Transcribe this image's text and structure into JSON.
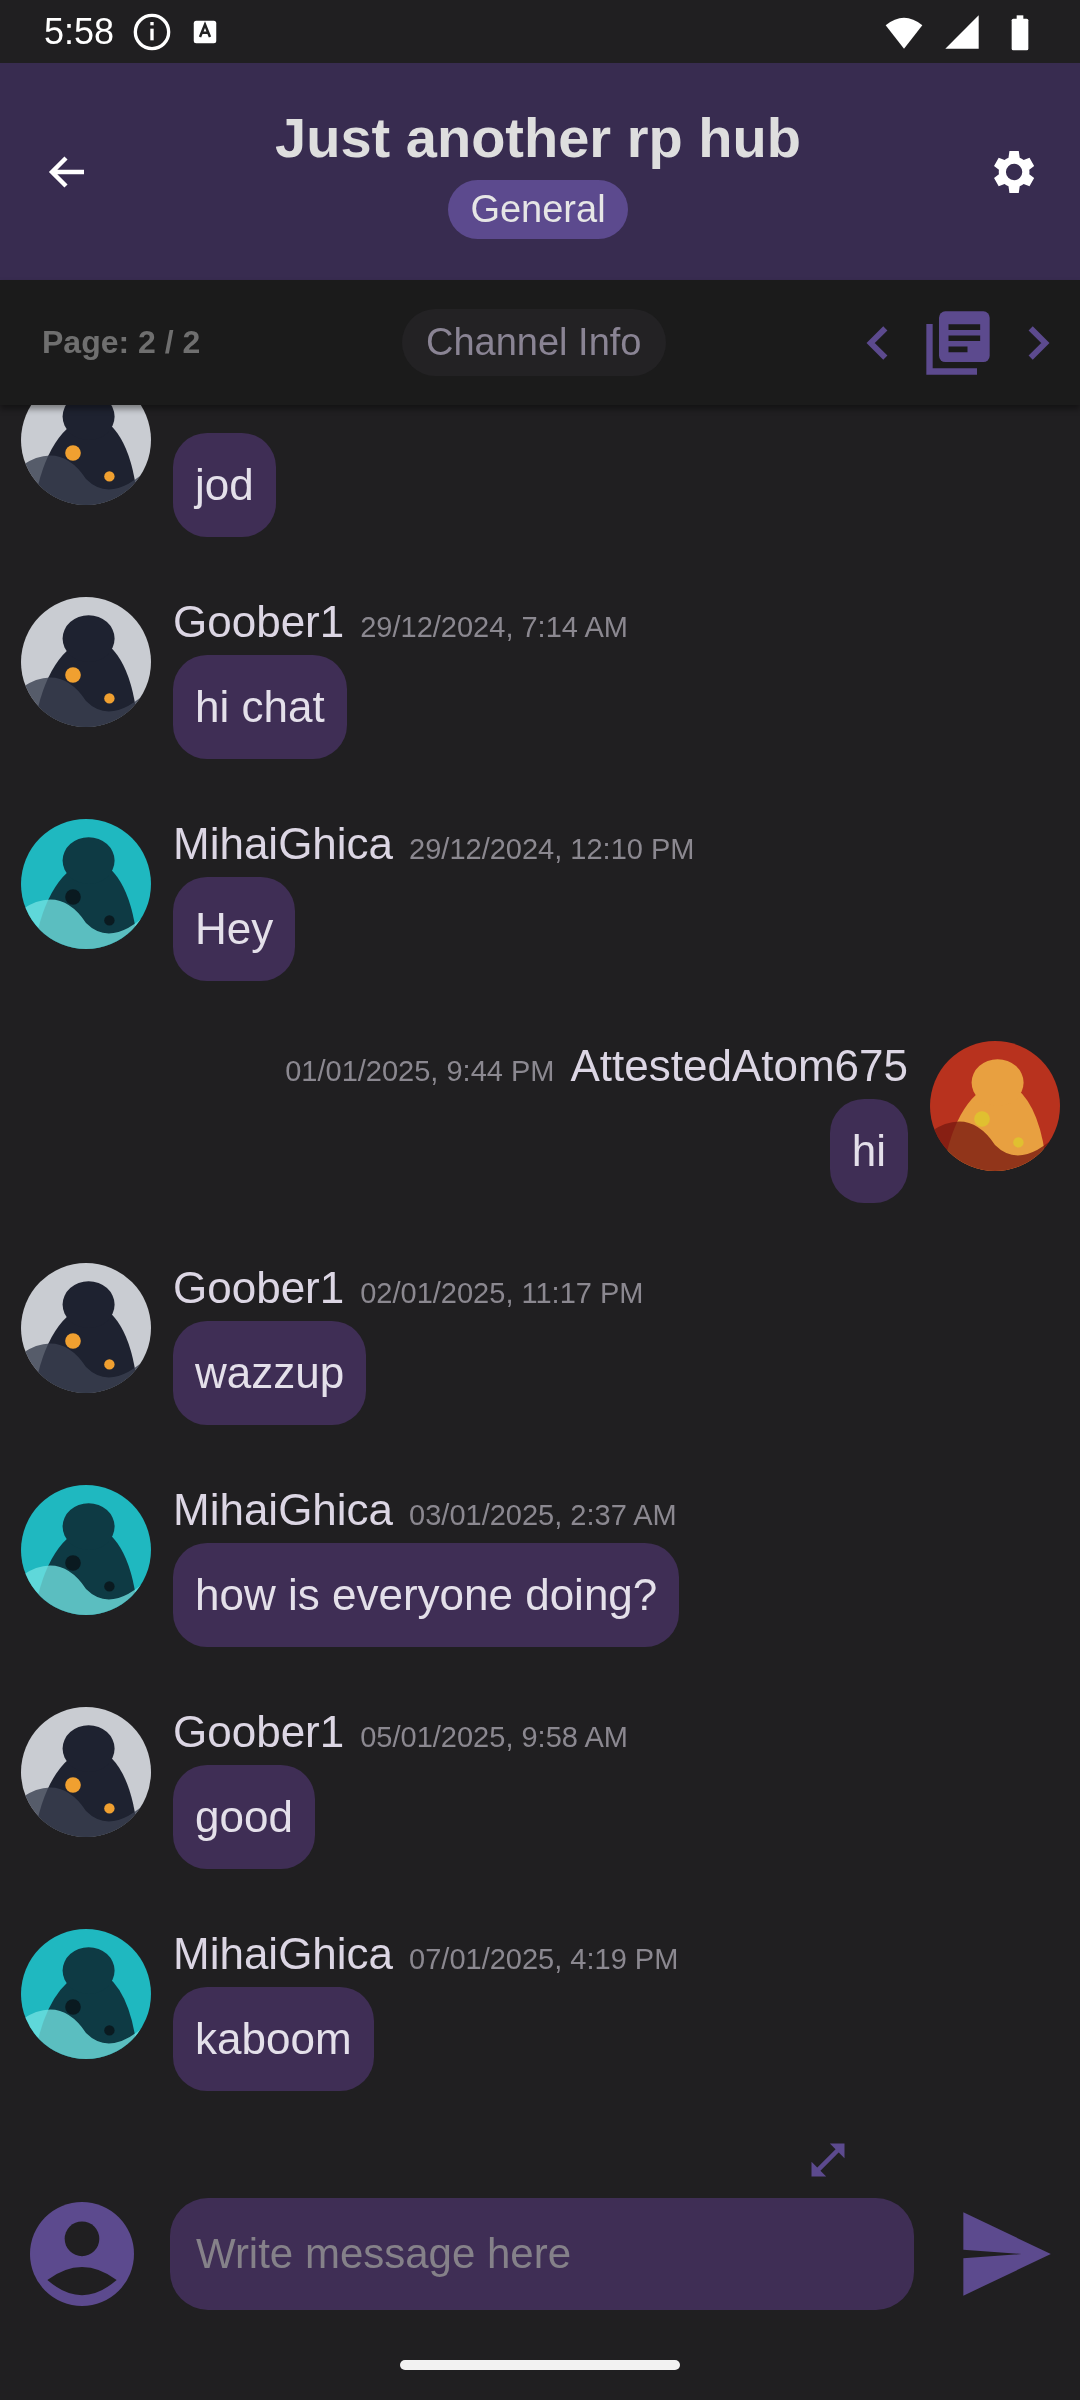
{
  "status_bar": {
    "time": "5:58"
  },
  "header": {
    "title": "Just another rp hub",
    "channel": "General"
  },
  "subbar": {
    "page": "Page: 2 / 2",
    "channel_info": "Channel Info"
  },
  "messages": [
    {
      "text": "jod",
      "outgoing": false
    },
    {
      "sender": "Goober1",
      "time": "29/12/2024, 7:14 AM",
      "text": "hi chat",
      "outgoing": false
    },
    {
      "sender": "MihaiGhica",
      "time": "29/12/2024, 12:10 PM",
      "text": "Hey",
      "outgoing": false
    },
    {
      "sender": "AttestedAtom675",
      "time": "01/01/2025, 9:44 PM",
      "text": "hi",
      "outgoing": true
    },
    {
      "sender": "Goober1",
      "time": "02/01/2025, 11:17 PM",
      "text": "wazzup",
      "outgoing": false
    },
    {
      "sender": "MihaiGhica",
      "time": "03/01/2025, 2:37 AM",
      "text": "how is everyone doing?",
      "outgoing": false
    },
    {
      "sender": "Goober1",
      "time": "05/01/2025, 9:58 AM",
      "text": "good",
      "outgoing": false
    },
    {
      "sender": "MihaiGhica",
      "time": "07/01/2025, 4:19 PM",
      "text": "kaboom",
      "outgoing": false
    }
  ],
  "composer": {
    "placeholder": "Write message here"
  }
}
